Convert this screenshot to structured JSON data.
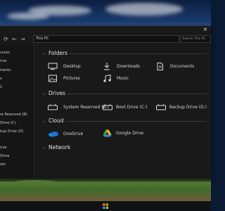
{
  "window": {
    "address": "This PC",
    "search_placeholder": "Search This PC",
    "close_label": "×"
  },
  "nav": {
    "refresh": "⟳",
    "back": "←",
    "forward": "→"
  },
  "sidebar": {
    "items": [
      {
        "label": "ccess"
      },
      {
        "label": "rive"
      },
      {
        "label": "ments"
      },
      {
        "label": "s"
      },
      {
        "label": "C"
      },
      {
        "label": "re Reserved (B)"
      },
      {
        "label": "Drive (C)"
      },
      {
        "label": "kup Drive (D)"
      },
      {
        "label": "rive"
      },
      {
        "label": "Drive"
      },
      {
        "label": "ork"
      }
    ]
  },
  "sections": {
    "folders": {
      "title": "Folders"
    },
    "drives": {
      "title": "Drives"
    },
    "cloud": {
      "title": "Cloud"
    },
    "network": {
      "title": "Network"
    }
  },
  "folders": [
    {
      "label": "Desktop",
      "icon": "desktop-icon"
    },
    {
      "label": "Downloads",
      "icon": "download-icon"
    },
    {
      "label": "Documents",
      "icon": "document-icon"
    },
    {
      "label": "Pictures",
      "icon": "picture-icon"
    },
    {
      "label": "Music",
      "icon": "music-icon"
    }
  ],
  "drives": [
    {
      "label": "System Reserved (B:)",
      "icon": "drive-icon"
    },
    {
      "label": "Boot Drive (C:)",
      "icon": "drive-icon"
    },
    {
      "label": "Backup Drive (D:)",
      "icon": "drive-icon"
    }
  ],
  "cloud": [
    {
      "label": "OneDrive",
      "icon": "onedrive-icon",
      "color": "#1e88e5"
    },
    {
      "label": "Google Drive",
      "icon": "google-drive-icon",
      "color": "#fbbc04"
    }
  ]
}
